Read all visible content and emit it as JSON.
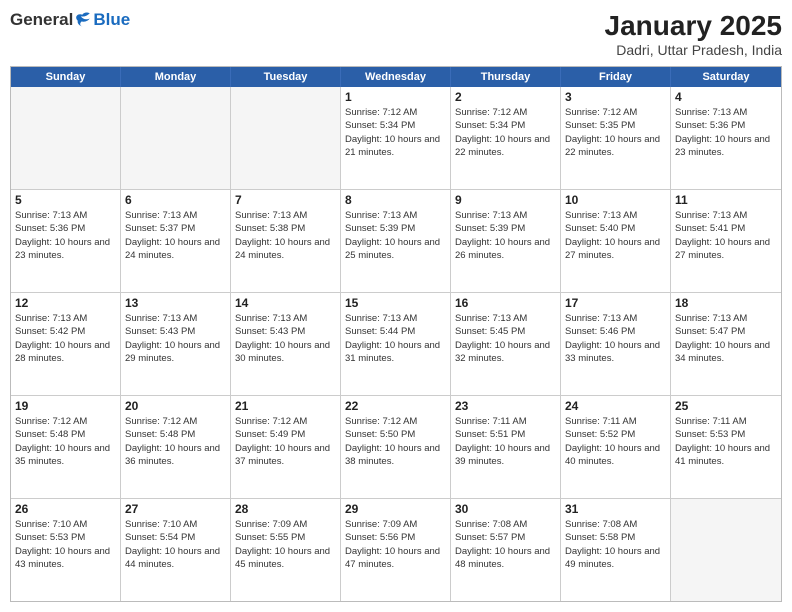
{
  "logo": {
    "general": "General",
    "blue": "Blue"
  },
  "title": "January 2025",
  "subtitle": "Dadri, Uttar Pradesh, India",
  "days_of_week": [
    "Sunday",
    "Monday",
    "Tuesday",
    "Wednesday",
    "Thursday",
    "Friday",
    "Saturday"
  ],
  "weeks": [
    [
      {
        "day": "",
        "info": ""
      },
      {
        "day": "",
        "info": ""
      },
      {
        "day": "",
        "info": ""
      },
      {
        "day": "1",
        "info": "Sunrise: 7:12 AM\nSunset: 5:34 PM\nDaylight: 10 hours and 21 minutes."
      },
      {
        "day": "2",
        "info": "Sunrise: 7:12 AM\nSunset: 5:34 PM\nDaylight: 10 hours and 22 minutes."
      },
      {
        "day": "3",
        "info": "Sunrise: 7:12 AM\nSunset: 5:35 PM\nDaylight: 10 hours and 22 minutes."
      },
      {
        "day": "4",
        "info": "Sunrise: 7:13 AM\nSunset: 5:36 PM\nDaylight: 10 hours and 23 minutes."
      }
    ],
    [
      {
        "day": "5",
        "info": "Sunrise: 7:13 AM\nSunset: 5:36 PM\nDaylight: 10 hours and 23 minutes."
      },
      {
        "day": "6",
        "info": "Sunrise: 7:13 AM\nSunset: 5:37 PM\nDaylight: 10 hours and 24 minutes."
      },
      {
        "day": "7",
        "info": "Sunrise: 7:13 AM\nSunset: 5:38 PM\nDaylight: 10 hours and 24 minutes."
      },
      {
        "day": "8",
        "info": "Sunrise: 7:13 AM\nSunset: 5:39 PM\nDaylight: 10 hours and 25 minutes."
      },
      {
        "day": "9",
        "info": "Sunrise: 7:13 AM\nSunset: 5:39 PM\nDaylight: 10 hours and 26 minutes."
      },
      {
        "day": "10",
        "info": "Sunrise: 7:13 AM\nSunset: 5:40 PM\nDaylight: 10 hours and 27 minutes."
      },
      {
        "day": "11",
        "info": "Sunrise: 7:13 AM\nSunset: 5:41 PM\nDaylight: 10 hours and 27 minutes."
      }
    ],
    [
      {
        "day": "12",
        "info": "Sunrise: 7:13 AM\nSunset: 5:42 PM\nDaylight: 10 hours and 28 minutes."
      },
      {
        "day": "13",
        "info": "Sunrise: 7:13 AM\nSunset: 5:43 PM\nDaylight: 10 hours and 29 minutes."
      },
      {
        "day": "14",
        "info": "Sunrise: 7:13 AM\nSunset: 5:43 PM\nDaylight: 10 hours and 30 minutes."
      },
      {
        "day": "15",
        "info": "Sunrise: 7:13 AM\nSunset: 5:44 PM\nDaylight: 10 hours and 31 minutes."
      },
      {
        "day": "16",
        "info": "Sunrise: 7:13 AM\nSunset: 5:45 PM\nDaylight: 10 hours and 32 minutes."
      },
      {
        "day": "17",
        "info": "Sunrise: 7:13 AM\nSunset: 5:46 PM\nDaylight: 10 hours and 33 minutes."
      },
      {
        "day": "18",
        "info": "Sunrise: 7:13 AM\nSunset: 5:47 PM\nDaylight: 10 hours and 34 minutes."
      }
    ],
    [
      {
        "day": "19",
        "info": "Sunrise: 7:12 AM\nSunset: 5:48 PM\nDaylight: 10 hours and 35 minutes."
      },
      {
        "day": "20",
        "info": "Sunrise: 7:12 AM\nSunset: 5:48 PM\nDaylight: 10 hours and 36 minutes."
      },
      {
        "day": "21",
        "info": "Sunrise: 7:12 AM\nSunset: 5:49 PM\nDaylight: 10 hours and 37 minutes."
      },
      {
        "day": "22",
        "info": "Sunrise: 7:12 AM\nSunset: 5:50 PM\nDaylight: 10 hours and 38 minutes."
      },
      {
        "day": "23",
        "info": "Sunrise: 7:11 AM\nSunset: 5:51 PM\nDaylight: 10 hours and 39 minutes."
      },
      {
        "day": "24",
        "info": "Sunrise: 7:11 AM\nSunset: 5:52 PM\nDaylight: 10 hours and 40 minutes."
      },
      {
        "day": "25",
        "info": "Sunrise: 7:11 AM\nSunset: 5:53 PM\nDaylight: 10 hours and 41 minutes."
      }
    ],
    [
      {
        "day": "26",
        "info": "Sunrise: 7:10 AM\nSunset: 5:53 PM\nDaylight: 10 hours and 43 minutes."
      },
      {
        "day": "27",
        "info": "Sunrise: 7:10 AM\nSunset: 5:54 PM\nDaylight: 10 hours and 44 minutes."
      },
      {
        "day": "28",
        "info": "Sunrise: 7:09 AM\nSunset: 5:55 PM\nDaylight: 10 hours and 45 minutes."
      },
      {
        "day": "29",
        "info": "Sunrise: 7:09 AM\nSunset: 5:56 PM\nDaylight: 10 hours and 47 minutes."
      },
      {
        "day": "30",
        "info": "Sunrise: 7:08 AM\nSunset: 5:57 PM\nDaylight: 10 hours and 48 minutes."
      },
      {
        "day": "31",
        "info": "Sunrise: 7:08 AM\nSunset: 5:58 PM\nDaylight: 10 hours and 49 minutes."
      },
      {
        "day": "",
        "info": ""
      }
    ]
  ]
}
